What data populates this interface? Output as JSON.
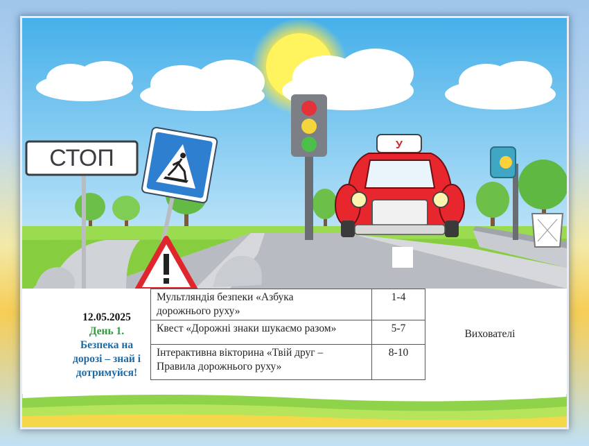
{
  "sign": {
    "stop_label": "СТОП",
    "car_badge": "У"
  },
  "schedule": {
    "date": "12.05.2025",
    "day": "День 1.",
    "topic_lines": [
      "Безпека на",
      "дорозі – знай і",
      "дотримуйся!"
    ],
    "rows": [
      {
        "activity_lines": [
          "Мультляндія безпеки  «Азбука",
          "дорожнього руху»"
        ],
        "age": "1-4"
      },
      {
        "activity_lines": [
          "Квест «Дорожні знаки шукаємо разом»"
        ],
        "age": "5-7"
      },
      {
        "activity_lines": [
          "Інтерактивна вікторина «Твій друг –",
          "Правила дорожнього руху»"
        ],
        "age": "8-10"
      }
    ],
    "responsible": "Вихователі"
  },
  "colors": {
    "sky_top": "#46b0ea",
    "grass": "#8fd34a",
    "car": "#e8262e",
    "sign_blue": "#2f7fd1"
  }
}
